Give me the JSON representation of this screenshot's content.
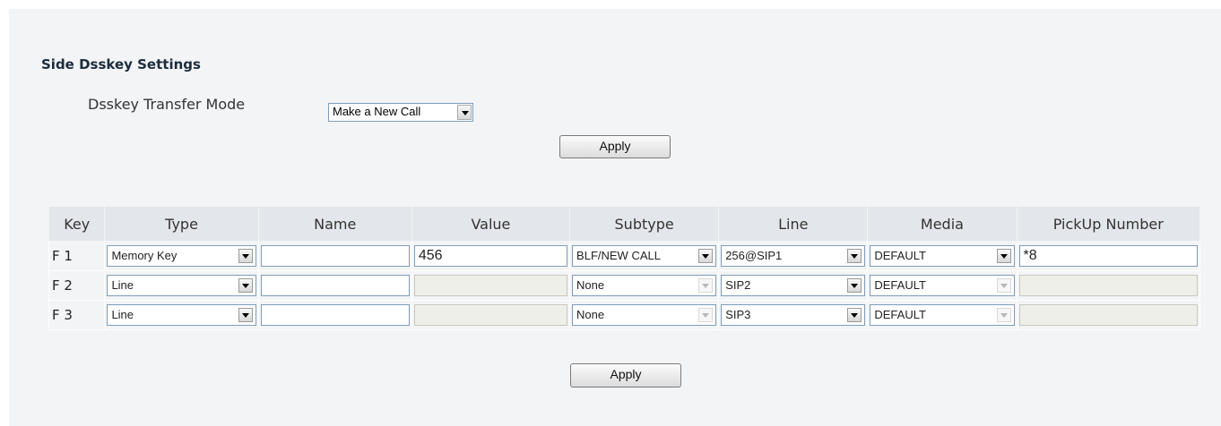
{
  "section_title": "Side Dsskey Settings",
  "transfer_mode": {
    "label": "Dsskey Transfer Mode",
    "value": "Make a New Call"
  },
  "apply_top_label": "Apply",
  "apply_bottom_label": "Apply",
  "table": {
    "headers": [
      "Key",
      "Type",
      "Name",
      "Value",
      "Subtype",
      "Line",
      "Media",
      "PickUp Number"
    ],
    "rows": [
      {
        "key": "F 1",
        "type": "Memory Key",
        "name": "",
        "value": "456",
        "subtype": "BLF/NEW CALL",
        "line": "256@SIP1",
        "media": "DEFAULT",
        "pickup": "*8"
      },
      {
        "key": "F 2",
        "type": "Line",
        "name": "",
        "value": "",
        "subtype": "None",
        "line": "SIP2",
        "media": "DEFAULT",
        "pickup": ""
      },
      {
        "key": "F 3",
        "type": "Line",
        "name": "",
        "value": "",
        "subtype": "None",
        "line": "SIP3",
        "media": "DEFAULT",
        "pickup": ""
      }
    ]
  }
}
